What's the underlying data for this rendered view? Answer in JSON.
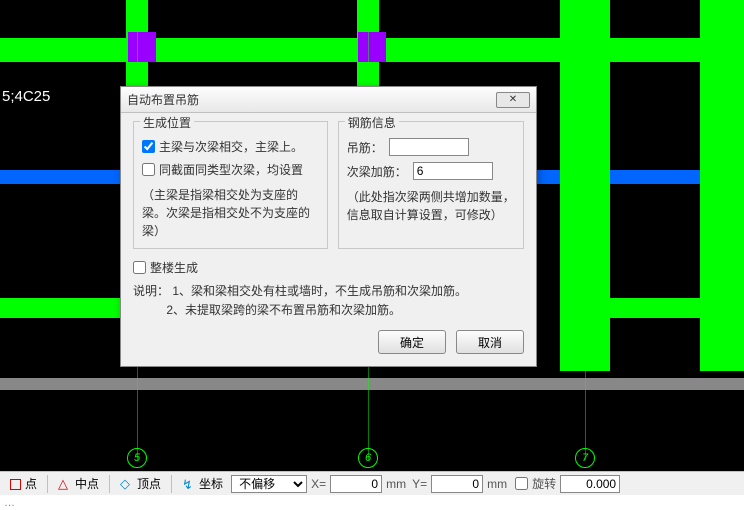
{
  "canvas": {
    "dim_text": "5;4C25",
    "grid_labels": [
      "5",
      "6",
      "7"
    ]
  },
  "dialog": {
    "title": "自动布置吊筋",
    "gen_pos": {
      "legend": "生成位置",
      "chk1_label": "主梁与次梁相交，主梁上。",
      "chk1_checked": true,
      "chk2_label": "同截面同类型次梁，均设置",
      "chk2_checked": false,
      "note": "（主梁是指梁相交处为支座的梁。次梁是指相交处不为支座的梁）"
    },
    "rebar": {
      "legend": "钢筋信息",
      "diaojin_label": "吊筋：",
      "diaojin_value": "",
      "ciliang_label": "次梁加筋：",
      "ciliang_value": "6",
      "note": "（此处指次梁两侧共增加数量，信息取自计算设置，可修改）"
    },
    "whole_floor_label": "整楼生成",
    "whole_floor_checked": false,
    "explain_label": "说明：",
    "explain_1": "1、梁和梁相交处有柱或墙时，不生成吊筋和次梁加筋。",
    "explain_2": "2、未提取梁跨的梁不布置吊筋和次梁加筋。",
    "ok": "确定",
    "cancel": "取消"
  },
  "status": {
    "endpoint": "点",
    "midpoint": "中点",
    "toppoint": "顶点",
    "zuobiao": "坐标",
    "offset_mode": "不偏移",
    "x_lbl": "X=",
    "x_val": "0",
    "x_unit": "mm",
    "y_lbl": "Y=",
    "y_val": "0",
    "y_unit": "mm",
    "rotate_lbl": "旋转",
    "rotate_val": "0.000",
    "footer_tail": "…"
  }
}
